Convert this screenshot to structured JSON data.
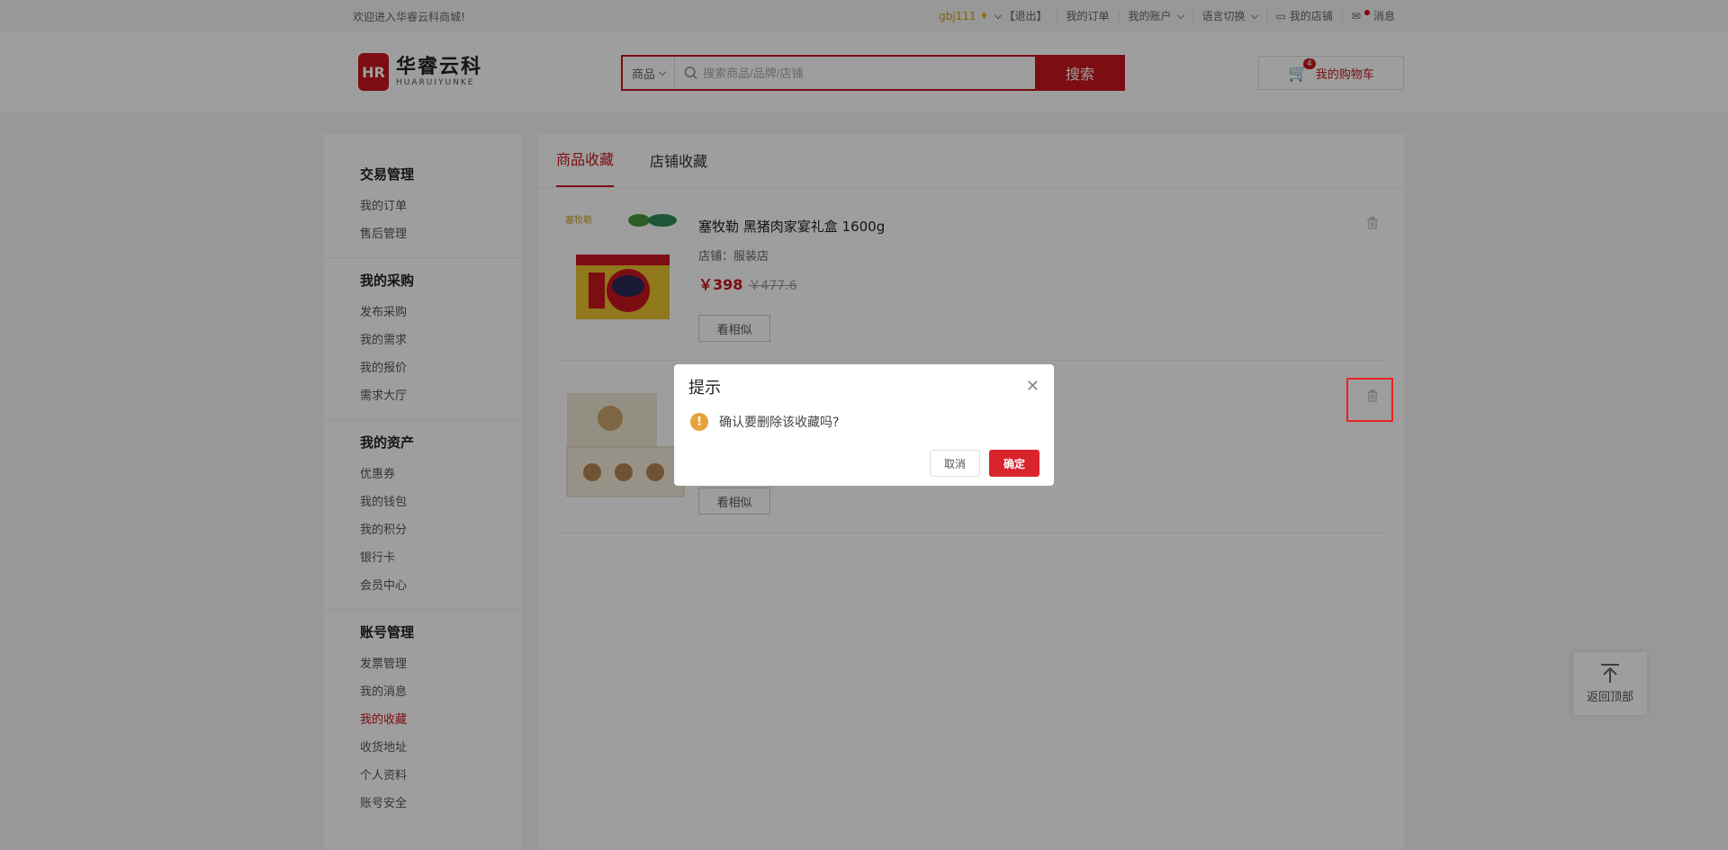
{
  "topbar": {
    "welcome": "欢迎进入华睿云科商城!",
    "username": "gbj111",
    "logout": "【退出】",
    "my_orders": "我的订单",
    "my_account": "我的账户",
    "language": "语言切换",
    "my_shop": "我的店铺",
    "messages": "消息"
  },
  "header": {
    "logo_cn": "华睿云科",
    "logo_en": "HUARUIYUNKE",
    "logo_mark": "HR",
    "search_category": "商品",
    "search_placeholder": "搜索商品/品牌/店铺",
    "search_button": "搜索",
    "cart_label": "我的购物车",
    "cart_count": "4"
  },
  "sidebar": {
    "groups": [
      {
        "title": "交易管理",
        "items": [
          "我的订单",
          "售后管理"
        ]
      },
      {
        "title": "我的采购",
        "items": [
          "发布采购",
          "我的需求",
          "我的报价",
          "需求大厅"
        ]
      },
      {
        "title": "我的资产",
        "items": [
          "优惠券",
          "我的钱包",
          "我的积分",
          "银行卡",
          "会员中心"
        ]
      },
      {
        "title": "账号管理",
        "items": [
          "发票管理",
          "我的消息",
          "我的收藏",
          "收货地址",
          "个人资料",
          "账号安全"
        ]
      }
    ],
    "active_item": "我的收藏"
  },
  "tabs": [
    "商品收藏",
    "店铺收藏"
  ],
  "items": [
    {
      "title": "塞牧勒 黑猪肉家宴礼盒 1600g",
      "shop": "店铺：服装店",
      "price": "￥398",
      "original_price": "￥477.6",
      "similar": "看相似"
    },
    {
      "title": "",
      "shop": "",
      "price": "",
      "original_price": "",
      "similar": "看相似"
    }
  ],
  "backtop": "返回顶部",
  "dialog": {
    "title": "提示",
    "message": "确认要删除该收藏吗?",
    "cancel": "取消",
    "confirm": "确定"
  },
  "colors": {
    "brand": "#c8161d",
    "warning": "#e6a23c",
    "highlight": "#e8251f"
  }
}
